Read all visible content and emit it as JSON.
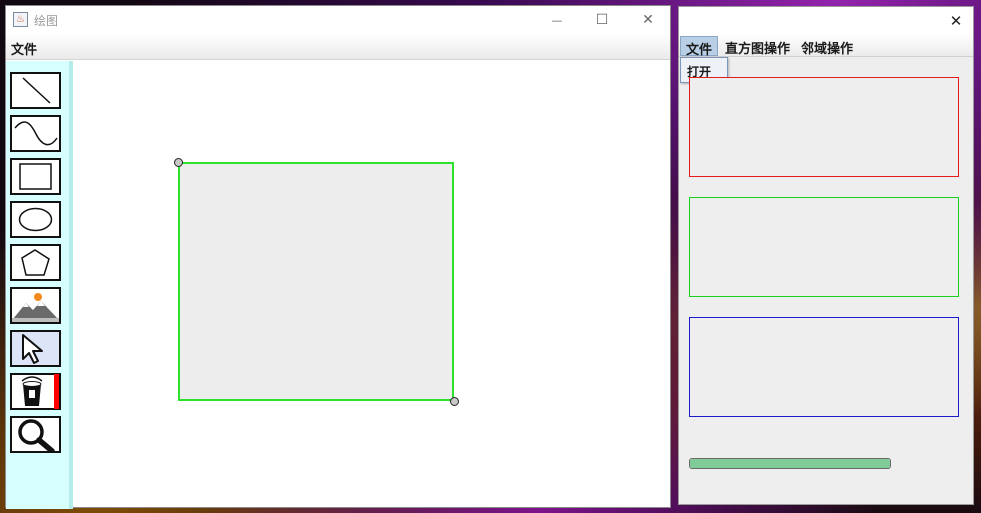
{
  "main_window": {
    "title": "绘图",
    "app_icon": "java-cup-icon",
    "menu": [
      "文件"
    ],
    "caption_buttons": {
      "minimize": "—",
      "maximize": "☐",
      "close": "✕"
    }
  },
  "toolbar": {
    "tools": [
      {
        "name": "line-tool",
        "icon": "line-icon"
      },
      {
        "name": "curve-tool",
        "icon": "curve-icon"
      },
      {
        "name": "rectangle-tool",
        "icon": "rectangle-icon"
      },
      {
        "name": "ellipse-tool",
        "icon": "ellipse-icon"
      },
      {
        "name": "polygon-tool",
        "icon": "pentagon-icon"
      },
      {
        "name": "image-tool",
        "icon": "mountain-image-icon"
      },
      {
        "name": "select-tool",
        "icon": "cursor-arrow-icon",
        "selected": true
      },
      {
        "name": "fill-tool",
        "icon": "paint-bucket-icon",
        "fill_color": "#ff0000"
      },
      {
        "name": "zoom-tool",
        "icon": "magnifier-icon"
      }
    ]
  },
  "canvas": {
    "shape": {
      "type": "rectangle",
      "stroke": "#2de12d",
      "fill": "#ededed"
    }
  },
  "process_window": {
    "close": "✕",
    "menu": [
      "文件",
      "直方图操作",
      "邻域操作"
    ],
    "active_menu": "文件",
    "dropdown": [
      "打开"
    ],
    "panels": [
      {
        "name": "red-channel-panel",
        "color": "#e31b1b"
      },
      {
        "name": "green-channel-panel",
        "color": "#1bd01b"
      },
      {
        "name": "blue-channel-panel",
        "color": "#1b1bc8"
      }
    ],
    "progress": {
      "value": 1.0,
      "color": "#7fcc98"
    }
  }
}
